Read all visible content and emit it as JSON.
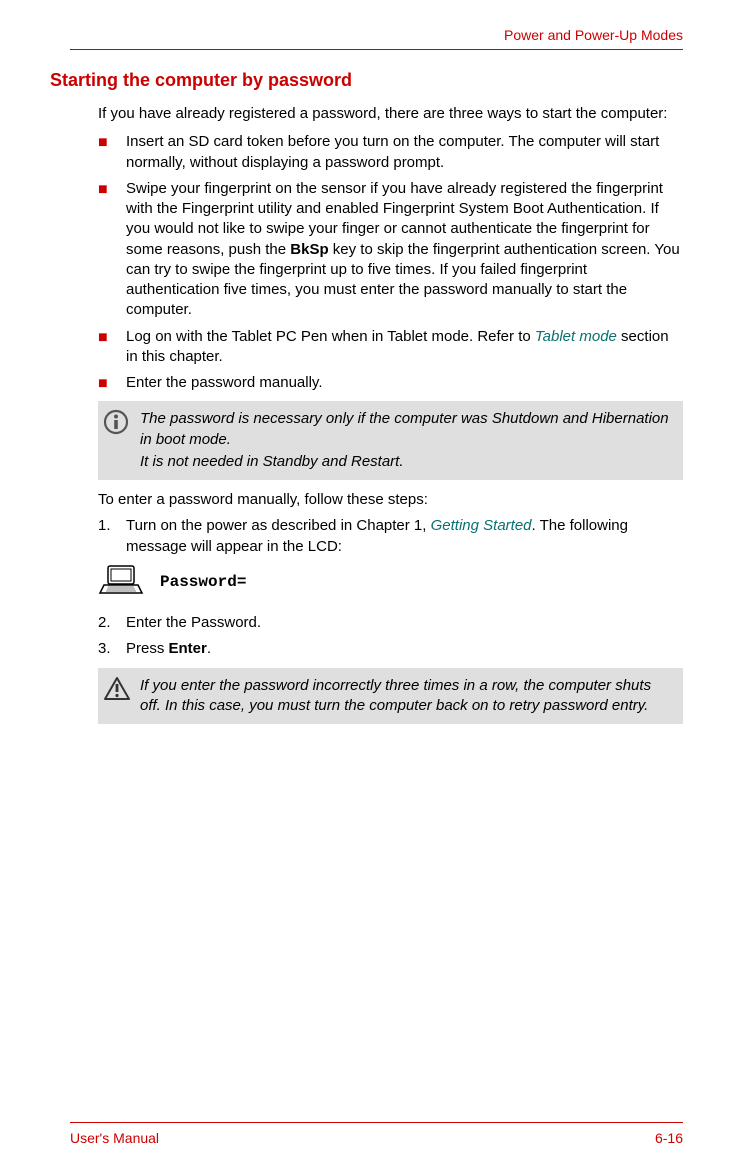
{
  "header": {
    "running_title": "Power and Power-Up Modes"
  },
  "section": {
    "title": "Starting the computer by password",
    "intro": "If you have already registered a password, there are three ways to start the computer:",
    "bullets": {
      "b0": "Insert an SD card token before you turn on the computer. The computer will start normally, without displaying a password prompt.",
      "b1_a": "Swipe your fingerprint on the sensor if you have already registered the fingerprint with the Fingerprint utility and enabled Fingerprint System Boot Authentication. If you would not like to swipe your finger or cannot authenticate the fingerprint for some reasons, push the ",
      "b1_key": "BkSp",
      "b1_b": " key to skip the fingerprint authentication screen. You can try to swipe the fingerprint up to five times. If you failed fingerprint authentication five times, you must enter the password manually to start the computer.",
      "b2_a": "Log on with the Tablet PC Pen when in Tablet mode. Refer to ",
      "b2_link": "Tablet mode",
      "b2_b": " section in this chapter.",
      "b3": "Enter the password manually."
    },
    "info1_line1": "The password is necessary only if the computer was Shutdown and Hibernation in boot mode.",
    "info1_line2": "It is not needed in Standby and Restart.",
    "steps_intro": "To enter a password manually, follow these steps:",
    "steps": {
      "s1_a": "Turn on the power as described in Chapter 1, ",
      "s1_link": "Getting Started",
      "s1_b": ". The following message will appear in the LCD:",
      "s2": "Enter the Password.",
      "s3_a": "Press ",
      "s3_key": "Enter",
      "s3_b": "."
    },
    "code": "Password=",
    "warning": "If you enter the password incorrectly three times in a row, the computer shuts off. In this case, you must turn the computer back on to retry password entry."
  },
  "footer": {
    "manual": "User's Manual",
    "page": "6-16"
  }
}
